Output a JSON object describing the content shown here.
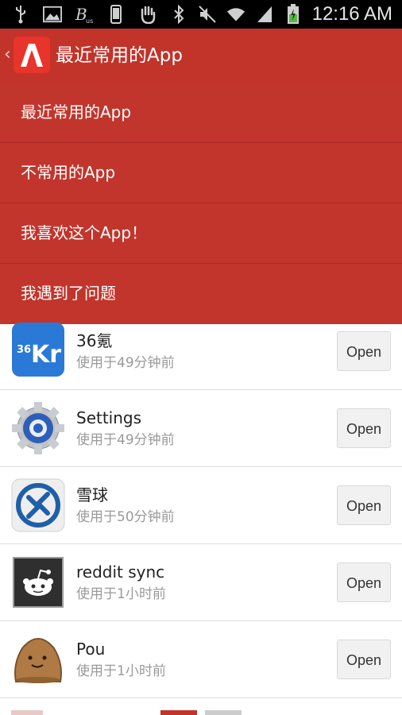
{
  "status_bar": {
    "time": "12:16 AM",
    "icons_left": [
      "usb-icon",
      "image-icon",
      "bus-icon",
      "phone-icon",
      "hand-icon"
    ],
    "icons_right": [
      "bluetooth-icon",
      "mute-icon",
      "wifi-icon",
      "signal-icon",
      "battery-charging-icon"
    ]
  },
  "action_bar": {
    "title": "最近常用的App",
    "logo_letter": "A",
    "color": "#c2332a"
  },
  "menu": {
    "items": [
      {
        "label": "最近常用的App"
      },
      {
        "label": "不常用的App"
      },
      {
        "label": "我喜欢这个App！"
      },
      {
        "label": "我遇到了问题"
      }
    ]
  },
  "apps": [
    {
      "name": "36氪",
      "time": "使用于49分钟前",
      "button": "Open",
      "icon": "36kr-icon"
    },
    {
      "name": "Settings",
      "time": "使用于49分钟前",
      "button": "Open",
      "icon": "settings-gear-icon"
    },
    {
      "name": "雪球",
      "time": "使用于50分钟前",
      "button": "Open",
      "icon": "xueqiu-icon"
    },
    {
      "name": "reddit sync",
      "time": "使用于1小时前",
      "button": "Open",
      "icon": "reddit-icon"
    },
    {
      "name": "Pou",
      "time": "使用于1小时前",
      "button": "Open",
      "icon": "pou-icon"
    }
  ]
}
